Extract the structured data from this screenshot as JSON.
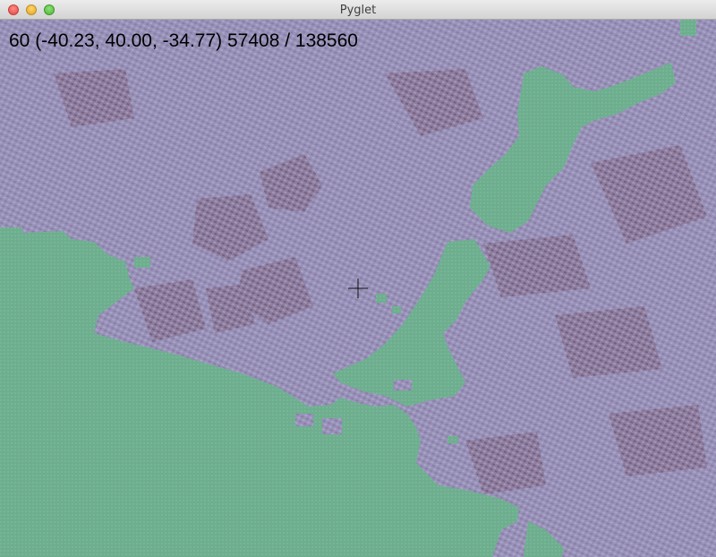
{
  "window": {
    "title": "Pyglet"
  },
  "hud": {
    "stats": "60 (-40.23, 40.00, -34.77) 57408 / 138560"
  },
  "terrain": {
    "ground_color": "#9a93ba",
    "ground_dark_color": "#7b6482",
    "water_color": "#6dae8e",
    "water_light_color": "#78c0a0"
  },
  "icons": {
    "close": "close-traffic-light-icon",
    "minimize": "minimize-traffic-light-icon",
    "zoom": "zoom-traffic-light-icon",
    "crosshair": "crosshair-icon"
  }
}
